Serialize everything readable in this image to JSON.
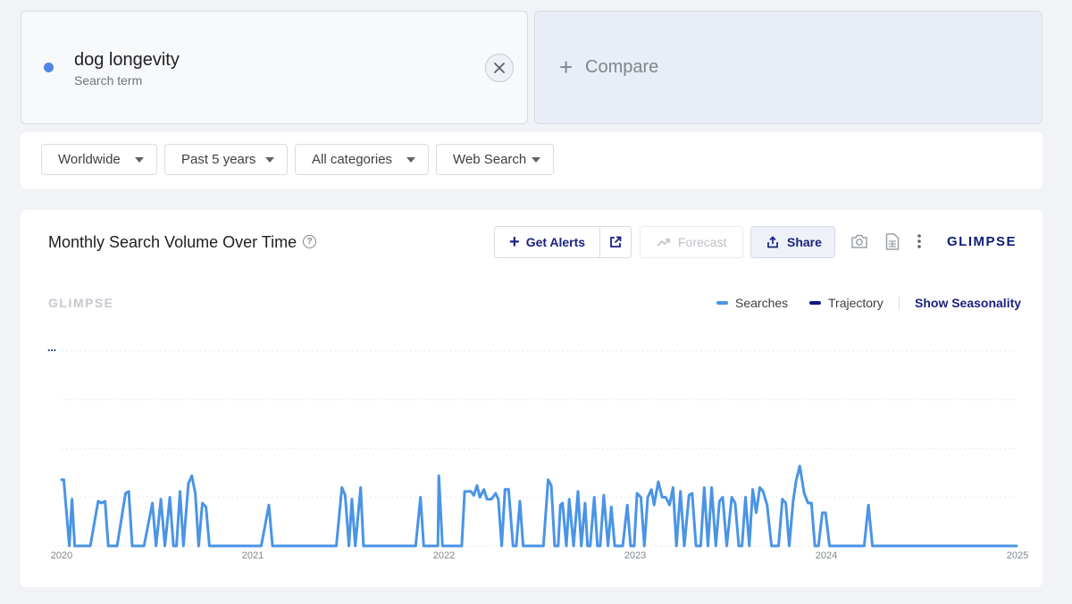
{
  "search_term": {
    "name": "dog longevity",
    "subtitle": "Search term",
    "color": "#4f86e8"
  },
  "compare": {
    "plus": "+",
    "label": "Compare"
  },
  "filters": [
    "Worldwide",
    "Past 5 years",
    "All categories",
    "Web Search"
  ],
  "chart_panel": {
    "title": "Monthly Search Volume Over Time",
    "help": "?",
    "buttons": {
      "alerts": "Get Alerts",
      "alerts_plus": "+",
      "forecast": "Forecast",
      "share": "Share"
    },
    "brand": "GLIMPSE",
    "watermark": "GLIMPSE",
    "legend": {
      "searches": "Searches",
      "trajectory": "Trajectory",
      "seasonality": "Show Seasonality"
    },
    "ellipsis": "...",
    "icons": [
      "plus-icon",
      "external-link-icon",
      "trend-icon",
      "share-icon",
      "camera-icon",
      "csv-file-icon",
      "more-vertical-icon"
    ],
    "colors": {
      "searches": "#4a94e6",
      "trajectory": "#0d1a8a",
      "brand": "#0d1b7a"
    }
  },
  "chart_data": {
    "type": "line",
    "x_labels": [
      "2020",
      "2021",
      "2022",
      "2023",
      "2024",
      "2025"
    ],
    "x_range": [
      2020,
      2025
    ],
    "y_range": [
      0,
      100
    ],
    "y_axis_labels": "hidden",
    "grid": true,
    "legend_position": "top-right",
    "series": [
      {
        "name": "Searches",
        "color": "#4a94e6",
        "points": [
          [
            2020.0,
            34
          ],
          [
            2020.011,
            34
          ],
          [
            2020.024,
            19
          ],
          [
            2020.04,
            0
          ],
          [
            2020.054,
            24
          ],
          [
            2020.068,
            0
          ],
          [
            2020.098,
            0
          ],
          [
            2020.15,
            0
          ],
          [
            2020.191,
            23
          ],
          [
            2020.209,
            22
          ],
          [
            2020.227,
            23
          ],
          [
            2020.244,
            0
          ],
          [
            2020.29,
            0
          ],
          [
            2020.334,
            27
          ],
          [
            2020.351,
            28
          ],
          [
            2020.369,
            0
          ],
          [
            2020.412,
            0
          ],
          [
            2020.431,
            0
          ],
          [
            2020.475,
            22
          ],
          [
            2020.494,
            0
          ],
          [
            2020.519,
            24
          ],
          [
            2020.54,
            0
          ],
          [
            2020.566,
            25
          ],
          [
            2020.585,
            0
          ],
          [
            2020.601,
            0
          ],
          [
            2020.619,
            28
          ],
          [
            2020.637,
            0
          ],
          [
            2020.663,
            32
          ],
          [
            2020.681,
            36
          ],
          [
            2020.699,
            27
          ],
          [
            2020.717,
            0
          ],
          [
            2020.736,
            22
          ],
          [
            2020.755,
            20
          ],
          [
            2020.773,
            0
          ],
          [
            2021.044,
            0
          ],
          [
            2021.084,
            21
          ],
          [
            2021.103,
            0
          ],
          [
            2021.42,
            0
          ],
          [
            2021.437,
            0
          ],
          [
            2021.466,
            30
          ],
          [
            2021.483,
            26
          ],
          [
            2021.503,
            0
          ],
          [
            2021.518,
            24
          ],
          [
            2021.536,
            0
          ],
          [
            2021.564,
            30
          ],
          [
            2021.579,
            0
          ],
          [
            2021.852,
            0
          ],
          [
            2021.877,
            25
          ],
          [
            2021.894,
            0
          ],
          [
            2021.914,
            0
          ],
          [
            2021.935,
            0
          ],
          [
            2021.968,
            0
          ],
          [
            2021.973,
            36
          ],
          [
            2021.992,
            0
          ],
          [
            2022.093,
            0
          ],
          [
            2022.108,
            28
          ],
          [
            2022.125,
            28
          ],
          [
            2022.141,
            28
          ],
          [
            2022.156,
            26
          ],
          [
            2022.173,
            31
          ],
          [
            2022.188,
            25
          ],
          [
            2022.209,
            29
          ],
          [
            2022.225,
            24
          ],
          [
            2022.248,
            24
          ],
          [
            2022.27,
            27
          ],
          [
            2022.284,
            24
          ],
          [
            2022.302,
            0
          ],
          [
            2022.319,
            29
          ],
          [
            2022.338,
            29
          ],
          [
            2022.361,
            0
          ],
          [
            2022.378,
            0
          ],
          [
            2022.397,
            23
          ],
          [
            2022.414,
            0
          ],
          [
            2022.432,
            0
          ],
          [
            2022.452,
            0
          ],
          [
            2022.469,
            0
          ],
          [
            2022.493,
            0
          ],
          [
            2022.52,
            0
          ],
          [
            2022.545,
            34
          ],
          [
            2022.561,
            31
          ],
          [
            2022.579,
            0
          ],
          [
            2022.597,
            0
          ],
          [
            2022.609,
            21
          ],
          [
            2022.62,
            22
          ],
          [
            2022.64,
            0
          ],
          [
            2022.655,
            24
          ],
          [
            2022.678,
            0
          ],
          [
            2022.701,
            28
          ],
          [
            2022.718,
            0
          ],
          [
            2022.738,
            22
          ],
          [
            2022.751,
            0
          ],
          [
            2022.765,
            0
          ],
          [
            2022.786,
            25
          ],
          [
            2022.803,
            0
          ],
          [
            2022.817,
            0
          ],
          [
            2022.836,
            26
          ],
          [
            2022.858,
            0
          ],
          [
            2022.875,
            20
          ],
          [
            2022.893,
            0
          ],
          [
            2022.915,
            0
          ],
          [
            2022.935,
            0
          ],
          [
            2022.959,
            21
          ],
          [
            2022.976,
            0
          ],
          [
            2022.995,
            0
          ],
          [
            2023.01,
            27
          ],
          [
            2023.03,
            25
          ],
          [
            2023.048,
            0
          ],
          [
            2023.066,
            25
          ],
          [
            2023.085,
            29
          ],
          [
            2023.099,
            21
          ],
          [
            2023.121,
            33
          ],
          [
            2023.141,
            25
          ],
          [
            2023.16,
            25
          ],
          [
            2023.18,
            21
          ],
          [
            2023.198,
            30
          ],
          [
            2023.216,
            0
          ],
          [
            2023.237,
            28
          ],
          [
            2023.257,
            0
          ],
          [
            2023.282,
            26
          ],
          [
            2023.298,
            27
          ],
          [
            2023.318,
            0
          ],
          [
            2023.343,
            0
          ],
          [
            2023.361,
            30
          ],
          [
            2023.381,
            0
          ],
          [
            2023.4,
            30
          ],
          [
            2023.422,
            0
          ],
          [
            2023.441,
            23
          ],
          [
            2023.458,
            25
          ],
          [
            2023.479,
            0
          ],
          [
            2023.505,
            25
          ],
          [
            2023.523,
            22
          ],
          [
            2023.542,
            0
          ],
          [
            2023.559,
            0
          ],
          [
            2023.577,
            25
          ],
          [
            2023.597,
            0
          ],
          [
            2023.615,
            29
          ],
          [
            2023.633,
            17
          ],
          [
            2023.652,
            30
          ],
          [
            2023.669,
            28
          ],
          [
            2023.69,
            21
          ],
          [
            2023.713,
            0
          ],
          [
            2023.732,
            0
          ],
          [
            2023.75,
            0
          ],
          [
            2023.77,
            24
          ],
          [
            2023.788,
            22
          ],
          [
            2023.806,
            0
          ],
          [
            2023.826,
            23
          ],
          [
            2023.843,
            34
          ],
          [
            2023.861,
            41
          ],
          [
            2023.884,
            27
          ],
          [
            2023.904,
            22
          ],
          [
            2023.922,
            22
          ],
          [
            2023.94,
            0
          ],
          [
            2023.959,
            0
          ],
          [
            2023.979,
            17
          ],
          [
            2023.996,
            17
          ],
          [
            2024.017,
            0
          ],
          [
            2024.04,
            0
          ],
          [
            2024.061,
            0
          ],
          [
            2024.08,
            0
          ],
          [
            2024.101,
            0
          ],
          [
            2024.12,
            0
          ],
          [
            2024.141,
            0
          ],
          [
            2024.16,
            0
          ],
          [
            2024.198,
            0
          ],
          [
            2024.22,
            21
          ],
          [
            2024.241,
            0
          ],
          [
            2024.256,
            0
          ],
          [
            2024.276,
            0
          ],
          [
            2024.295,
            0
          ],
          [
            2024.317,
            0
          ],
          [
            2024.337,
            0
          ],
          [
            2024.372,
            0
          ],
          [
            2024.39,
            0
          ],
          [
            2024.411,
            0
          ],
          [
            2024.431,
            0
          ],
          [
            2024.451,
            0
          ],
          [
            2024.471,
            0
          ],
          [
            2024.491,
            0
          ],
          [
            2024.51,
            0
          ],
          [
            2024.531,
            0
          ],
          [
            2024.551,
            0
          ],
          [
            2024.572,
            0
          ],
          [
            2024.592,
            0
          ],
          [
            2024.611,
            0
          ],
          [
            2024.632,
            0
          ],
          [
            2024.651,
            0
          ],
          [
            2024.672,
            0
          ],
          [
            2024.692,
            0
          ],
          [
            2024.712,
            0
          ],
          [
            2024.733,
            0
          ],
          [
            2024.752,
            0
          ],
          [
            2024.773,
            0
          ],
          [
            2024.793,
            0
          ],
          [
            2024.813,
            0
          ],
          [
            2024.833,
            0
          ],
          [
            2024.853,
            0
          ],
          [
            2024.873,
            0
          ],
          [
            2024.894,
            0
          ],
          [
            2024.914,
            0
          ],
          [
            2024.934,
            0
          ],
          [
            2024.955,
            0
          ],
          [
            2024.975,
            0
          ],
          [
            2024.995,
            0
          ]
        ]
      },
      {
        "name": "Trajectory",
        "color": "#0d1a8a",
        "points": []
      }
    ]
  }
}
